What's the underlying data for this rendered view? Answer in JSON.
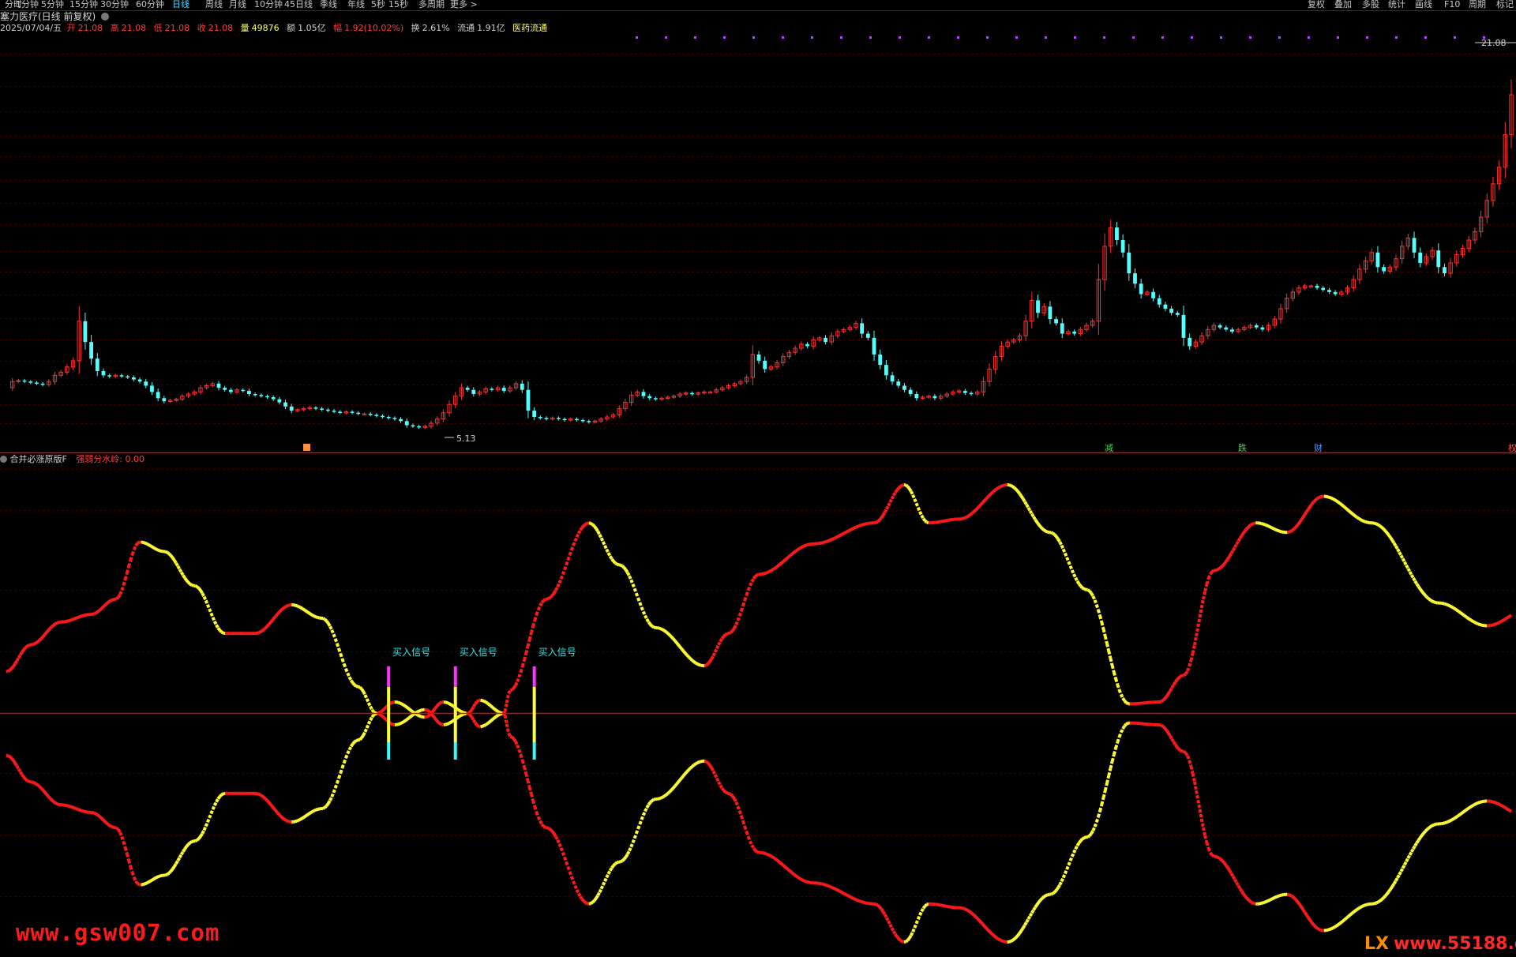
{
  "toolbar": {
    "periods": [
      "分时",
      "1分钟",
      "5分钟",
      "15分钟",
      "30分钟",
      "60分钟",
      "日线",
      "周线",
      "月线",
      "10分钟",
      "45日线",
      "季线",
      "年线",
      "5秒",
      "15秒",
      "多周期",
      "更多 >"
    ],
    "active_period": "日线",
    "right_tools": [
      "复权",
      "叠加",
      "多股",
      "统计",
      "画线",
      "F10",
      "周期",
      "标记"
    ]
  },
  "stock": {
    "title": "塞力医疗(日线 前复权)",
    "date": "2025/07/04/五",
    "open_label": "开",
    "open": "21.08",
    "high_label": "高",
    "high": "21.08",
    "low_label": "低",
    "low": "21.08",
    "close_label": "收",
    "close": "21.08",
    "volume_label": "量",
    "volume": "49876",
    "amount_label": "额",
    "amount": "1.05亿",
    "change_label": "幅",
    "change": "1.92(10.02%)",
    "turnover_label": "换",
    "turnover": "2.61%",
    "float_label": "流通",
    "float": "1.91亿",
    "sector": "医药流通"
  },
  "price_labels": {
    "high_price": "21.08",
    "low_price": "5.13"
  },
  "event_markers": [
    "减",
    "跌",
    "财",
    "权"
  ],
  "indicator": {
    "name": "合并必涨原版F",
    "param_label": "强弱分水岭:",
    "param_value": "0.00",
    "signal_label": "买入信号"
  },
  "watermarks": {
    "left": "www.gsw007.com",
    "right_logo": "LX",
    "right": "www.55188.com"
  },
  "colors": {
    "up_candle": "#ff3030",
    "down_candle": "#54ffff",
    "wave_up": "#ff1a1a",
    "wave_down": "#ffff33",
    "signal_top": "#ff33ff",
    "signal_mid": "#ffff33",
    "signal_bottom": "#33ffff",
    "grid": "#3a0000",
    "axis_line": "#cc1010"
  },
  "chart_data": [
    {
      "type": "candlestick",
      "title": "塞力医疗(日线 前复权)",
      "x_unit": "trading day index (0 = left edge, 287 = 2025/07/04)",
      "y_unit": "price (CNY)",
      "ylim": [
        4.5,
        22.0
      ],
      "annotations": [
        {
          "text": "21.08",
          "x": 287,
          "y": 21.08
        },
        {
          "text": "5.13",
          "x": 85,
          "y": 5.13
        }
      ],
      "closes": [
        7.0,
        7.3,
        7.35,
        7.3,
        7.25,
        7.2,
        7.15,
        7.3,
        7.6,
        7.75,
        8.0,
        8.3,
        10.2,
        9.2,
        8.4,
        7.8,
        7.6,
        7.55,
        7.6,
        7.55,
        7.5,
        7.4,
        7.3,
        7.1,
        6.8,
        6.5,
        6.35,
        6.4,
        6.45,
        6.6,
        6.7,
        6.8,
        7.0,
        7.1,
        7.2,
        7.0,
        6.9,
        6.8,
        6.9,
        6.85,
        6.7,
        6.65,
        6.6,
        6.55,
        6.45,
        6.3,
        6.1,
        5.9,
        5.95,
        6.0,
        6.05,
        6.0,
        5.95,
        5.9,
        5.85,
        5.8,
        5.85,
        5.8,
        5.75,
        5.75,
        5.7,
        5.65,
        5.6,
        5.55,
        5.5,
        5.4,
        5.2,
        5.15,
        5.1,
        5.15,
        5.3,
        5.5,
        5.8,
        6.2,
        6.6,
        7.0,
        6.9,
        6.7,
        6.8,
        6.95,
        6.9,
        7.0,
        6.85,
        7.0,
        7.2,
        6.9,
        5.9,
        5.6,
        5.55,
        5.5,
        5.55,
        5.5,
        5.45,
        5.5,
        5.45,
        5.4,
        5.35,
        5.4,
        5.5,
        5.6,
        5.7,
        6.0,
        6.3,
        6.65,
        6.8,
        6.6,
        6.5,
        6.45,
        6.5,
        6.55,
        6.6,
        6.7,
        6.75,
        6.7,
        6.75,
        6.8,
        6.8,
        6.9,
        7.0,
        7.1,
        7.2,
        7.3,
        7.5,
        8.6,
        8.3,
        7.9,
        8.0,
        8.2,
        8.5,
        8.7,
        8.9,
        9.1,
        9.0,
        9.3,
        9.4,
        9.2,
        9.5,
        9.7,
        9.8,
        9.9,
        10.1,
        9.6,
        9.4,
        8.6,
        8.1,
        7.6,
        7.3,
        7.1,
        6.9,
        6.7,
        6.5,
        6.55,
        6.6,
        6.5,
        6.6,
        6.7,
        6.8,
        6.85,
        6.75,
        6.7,
        6.8,
        7.3,
        7.9,
        8.5,
        9.0,
        9.2,
        9.3,
        9.5,
        10.2,
        11.2,
        10.6,
        10.9,
        10.3,
        10.1,
        9.6,
        9.7,
        9.6,
        9.8,
        10.0,
        10.2,
        12.2,
        13.8,
        14.7,
        14.1,
        13.5,
        12.5,
        12.0,
        11.5,
        11.6,
        11.3,
        11.0,
        10.8,
        10.6,
        10.5,
        9.4,
        9.0,
        9.2,
        9.5,
        9.8,
        10.0,
        9.9,
        9.8,
        9.7,
        9.8,
        9.9,
        10.0,
        9.9,
        9.8,
        10.0,
        10.3,
        10.8,
        11.3,
        11.6,
        11.8,
        11.9,
        11.9,
        11.8,
        11.7,
        11.6,
        11.5,
        11.6,
        11.8,
        12.2,
        12.7,
        13.1,
        13.5,
        12.8,
        12.6,
        12.8,
        13.2,
        13.8,
        14.2,
        13.5,
        13.0,
        13.3,
        13.6,
        12.8,
        12.5,
        13.0,
        13.4,
        13.7,
        14.1,
        14.5,
        15.2,
        16.0,
        16.8,
        17.6,
        19.16,
        21.08
      ]
    },
    {
      "type": "line",
      "title": "合并必涨原版F",
      "x_unit": "trading day index",
      "y_unit": "oscillator value (0 = 强弱分水岭)",
      "ylim": [
        -1.0,
        1.0
      ],
      "series": [
        {
          "name": "",
          "coloring": "red when rising, yellow when falling",
          "points": [
            [
              0,
              0.22
            ],
            [
              4,
              0.36
            ],
            [
              9,
              0.48
            ],
            [
              14,
              0.52
            ],
            [
              18,
              0.6
            ],
            [
              22,
              0.9
            ],
            [
              26,
              0.85
            ],
            [
              31,
              0.67
            ],
            [
              36,
              0.42
            ],
            [
              41,
              0.42
            ],
            [
              47,
              0.57
            ],
            [
              52,
              0.5
            ],
            [
              58,
              0.14
            ],
            [
              61,
              0.0
            ],
            [
              64,
              0.06
            ],
            [
              69,
              -0.02
            ],
            [
              72,
              0.06
            ],
            [
              76,
              0.0
            ],
            [
              78,
              0.07
            ],
            [
              82,
              0.0
            ],
            [
              83,
              0.12
            ],
            [
              89,
              0.6
            ],
            [
              96,
              1.0
            ],
            [
              101,
              0.78
            ],
            [
              107,
              0.45
            ],
            [
              115,
              0.25
            ],
            [
              119,
              0.42
            ],
            [
              124,
              0.73
            ],
            [
              133,
              0.89
            ],
            [
              143,
              1.0
            ],
            [
              148,
              1.2
            ],
            [
              152,
              1.0
            ],
            [
              157,
              1.02
            ],
            [
              165,
              1.2
            ],
            [
              172,
              0.95
            ],
            [
              178,
              0.65
            ],
            [
              185,
              0.05
            ],
            [
              190,
              0.06
            ],
            [
              194,
              0.2
            ],
            [
              199,
              0.75
            ],
            [
              206,
              1.0
            ],
            [
              211,
              0.95
            ],
            [
              217,
              1.14
            ],
            [
              225,
              1.0
            ],
            [
              236,
              0.58
            ],
            [
              244,
              0.46
            ],
            [
              251,
              0.55
            ],
            [
              259,
              0.56
            ],
            [
              264,
              0.68
            ],
            [
              271,
              0.8
            ],
            [
              276,
              0.89
            ],
            [
              281,
              0.96
            ],
            [
              287,
              1.21
            ]
          ]
        },
        {
          "name": "",
          "coloring": "mirror of first series about zero",
          "mirror_of": 0
        }
      ],
      "signals": [
        {
          "x": 63,
          "label": "买入信号"
        },
        {
          "x": 74,
          "label": "买入信号"
        },
        {
          "x": 87,
          "label": "买入信号"
        }
      ]
    }
  ]
}
